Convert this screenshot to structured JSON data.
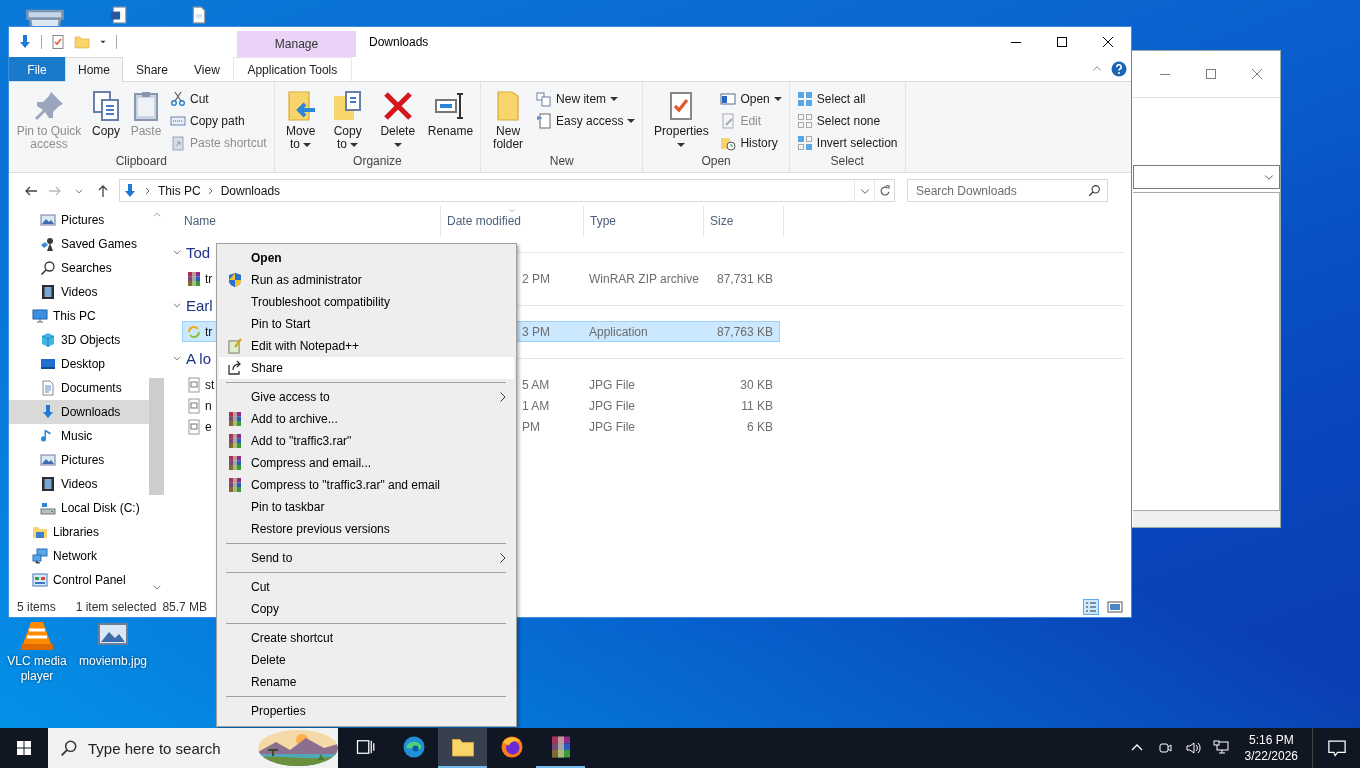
{
  "desktop_icons": [
    {
      "label": "VLC media player"
    },
    {
      "label": "moviemb.jpg"
    }
  ],
  "explorer": {
    "title": "Downloads",
    "context_group": "Manage",
    "tabs": [
      {
        "label": "File",
        "kind": "file",
        "selected": false
      },
      {
        "label": "Home",
        "kind": "tab",
        "selected": true
      },
      {
        "label": "Share",
        "kind": "tab",
        "selected": false
      },
      {
        "label": "View",
        "kind": "tab",
        "selected": false
      },
      {
        "label": "Application Tools",
        "kind": "context",
        "selected": false
      }
    ],
    "ribbon_groups": [
      {
        "label": "Clipboard",
        "items": [
          {
            "label": "Pin to Quick access",
            "kind": "large",
            "disabled": true,
            "dropdown": false
          },
          {
            "label": "Copy",
            "kind": "large",
            "disabled": false,
            "dropdown": false
          },
          {
            "label": "Paste",
            "kind": "large",
            "disabled": true,
            "dropdown": false
          },
          {
            "label": "Cut",
            "kind": "small",
            "disabled": false,
            "dropdown": false
          },
          {
            "label": "Copy path",
            "kind": "small",
            "disabled": false,
            "dropdown": false
          },
          {
            "label": "Paste shortcut",
            "kind": "small",
            "disabled": true,
            "dropdown": false
          }
        ]
      },
      {
        "label": "Organize",
        "items": [
          {
            "label": "Move to",
            "kind": "large",
            "disabled": false,
            "dropdown": true
          },
          {
            "label": "Copy to",
            "kind": "large",
            "disabled": false,
            "dropdown": true
          },
          {
            "label": "Delete",
            "kind": "large",
            "disabled": false,
            "dropdown": true
          },
          {
            "label": "Rename",
            "kind": "large",
            "disabled": false,
            "dropdown": false
          }
        ]
      },
      {
        "label": "New",
        "items": [
          {
            "label": "New folder",
            "kind": "large",
            "disabled": false,
            "dropdown": false
          },
          {
            "label": "New item",
            "kind": "small",
            "disabled": false,
            "dropdown": true
          },
          {
            "label": "Easy access",
            "kind": "small",
            "disabled": false,
            "dropdown": true
          }
        ]
      },
      {
        "label": "Open",
        "items": [
          {
            "label": "Properties",
            "kind": "large",
            "disabled": false,
            "dropdown": true
          },
          {
            "label": "Open",
            "kind": "small",
            "disabled": false,
            "dropdown": true
          },
          {
            "label": "Edit",
            "kind": "small",
            "disabled": true,
            "dropdown": false
          },
          {
            "label": "History",
            "kind": "small",
            "disabled": false,
            "dropdown": false
          }
        ]
      },
      {
        "label": "Select",
        "items": [
          {
            "label": "Select all",
            "kind": "small",
            "disabled": false,
            "dropdown": false
          },
          {
            "label": "Select none",
            "kind": "small",
            "disabled": false,
            "dropdown": false
          },
          {
            "label": "Invert selection",
            "kind": "small",
            "disabled": false,
            "dropdown": false
          }
        ]
      }
    ],
    "breadcrumbs": [
      "This PC",
      "Downloads"
    ],
    "search_placeholder": "Search Downloads",
    "nav_tree": [
      {
        "children": [
          {
            "label": "Pictures",
            "selected": false
          },
          {
            "label": "Saved Games",
            "selected": false
          },
          {
            "label": "Searches",
            "selected": false
          },
          {
            "label": "Videos",
            "selected": false
          }
        ]
      },
      {
        "label": "This PC",
        "selected": false,
        "children": [
          {
            "label": "3D Objects",
            "selected": false
          },
          {
            "label": "Desktop",
            "selected": false
          },
          {
            "label": "Documents",
            "selected": false
          },
          {
            "label": "Downloads",
            "selected": true
          },
          {
            "label": "Music",
            "selected": false
          },
          {
            "label": "Pictures",
            "selected": false
          },
          {
            "label": "Videos",
            "selected": false
          },
          {
            "label": "Local Disk (C:)",
            "selected": false
          }
        ]
      },
      {
        "label": "Libraries",
        "selected": false
      },
      {
        "label": "Network",
        "selected": false
      },
      {
        "label": "Control Panel",
        "selected": false
      }
    ],
    "columns": [
      "Name",
      "Date modified",
      "Type",
      "Size"
    ],
    "groups": [
      {
        "label": "Tod",
        "rows": [
          {
            "name": "tr",
            "date": "2 PM",
            "type": "WinRAR ZIP archive",
            "size": "87,731 KB",
            "selected": false
          }
        ]
      },
      {
        "label": "Earl",
        "rows": [
          {
            "name": "tr",
            "date": "3 PM",
            "type": "Application",
            "size": "87,763 KB",
            "selected": true
          }
        ]
      },
      {
        "label": "A lo",
        "rows": [
          {
            "name": "st",
            "date": "5 AM",
            "type": "JPG File",
            "size": "30 KB",
            "selected": false
          },
          {
            "name": "n",
            "date": "1 AM",
            "type": "JPG File",
            "size": "11 KB",
            "selected": false
          },
          {
            "name": "e",
            "date": "PM",
            "type": "JPG File",
            "size": "6 KB",
            "selected": false
          }
        ]
      }
    ],
    "status": {
      "count": "5 items",
      "selection": "1 item selected",
      "size": "85.7 MB"
    }
  },
  "context_menu": [
    {
      "label": "Open",
      "kind": "default",
      "selected": false
    },
    {
      "label": "Run as administrator",
      "kind": "item",
      "selected": false
    },
    {
      "label": "Troubleshoot compatibility",
      "kind": "item",
      "selected": false
    },
    {
      "label": "Pin to Start",
      "kind": "item",
      "selected": false
    },
    {
      "label": "Edit with Notepad++",
      "kind": "item",
      "selected": false
    },
    {
      "label": "Share",
      "kind": "item",
      "selected": true
    },
    {
      "kind": "separator"
    },
    {
      "label": "Give access to",
      "kind": "submenu",
      "selected": false
    },
    {
      "label": "Add to archive...",
      "kind": "item",
      "selected": false
    },
    {
      "label": "Add to \"traffic3.rar\"",
      "kind": "item",
      "selected": false
    },
    {
      "label": "Compress and email...",
      "kind": "item",
      "selected": false
    },
    {
      "label": "Compress to \"traffic3.rar\" and email",
      "kind": "item",
      "selected": false
    },
    {
      "label": "Pin to taskbar",
      "kind": "item",
      "selected": false
    },
    {
      "label": "Restore previous versions",
      "kind": "item",
      "selected": false
    },
    {
      "kind": "separator"
    },
    {
      "label": "Send to",
      "kind": "submenu",
      "selected": false
    },
    {
      "kind": "separator"
    },
    {
      "label": "Cut",
      "kind": "item",
      "selected": false
    },
    {
      "label": "Copy",
      "kind": "item",
      "selected": false
    },
    {
      "kind": "separator"
    },
    {
      "label": "Create shortcut",
      "kind": "item",
      "selected": false
    },
    {
      "label": "Delete",
      "kind": "item",
      "selected": false
    },
    {
      "label": "Rename",
      "kind": "item",
      "selected": false
    },
    {
      "kind": "separator"
    },
    {
      "label": "Properties",
      "kind": "item",
      "selected": false
    }
  ],
  "taskbar": {
    "search_placeholder": "Type here to search",
    "apps": [
      {
        "selected": false,
        "running": false
      },
      {
        "selected": false,
        "running": false
      },
      {
        "selected": true,
        "running": true
      },
      {
        "selected": false,
        "running": false
      },
      {
        "selected": false,
        "running": true
      }
    ],
    "time": "5:16 PM",
    "date": "3/22/2026"
  }
}
